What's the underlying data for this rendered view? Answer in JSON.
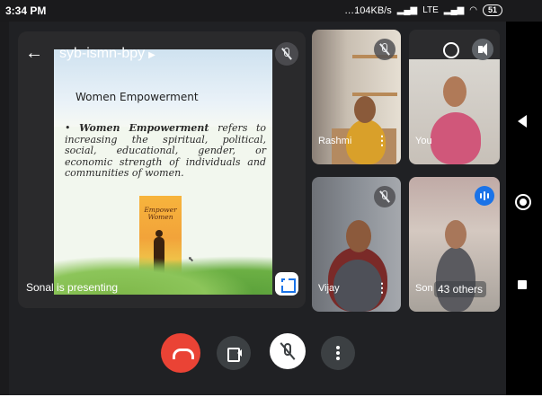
{
  "status_bar": {
    "time": "3:34 PM",
    "network_speed": "104KB/s",
    "network_type": "LTE",
    "battery": "51"
  },
  "meeting": {
    "code": "syb-ismn-bpy",
    "presenter_label": "Sonal is presenting"
  },
  "slide": {
    "title": "Women Empowerment",
    "bullet_lead": "Women Empowerment",
    "bullet_text": "refers to increasing the spiritual, political, social, educational, gender, or economic strength of individuals and communities of women.",
    "book_title_line1": "Empower",
    "book_title_line2": "Women"
  },
  "participants": [
    {
      "name": "Rashmi",
      "muted": true
    },
    {
      "name": "You",
      "muted": false
    },
    {
      "name": "Vijay",
      "muted": true
    },
    {
      "name": "Son",
      "muted": false,
      "speaking": true
    }
  ],
  "others_count_label": "43 others",
  "colors": {
    "end_call": "#ea4335",
    "accent": "#1a73e8",
    "background": "#202124"
  },
  "icons": {
    "back": "back-arrow-icon",
    "camera_switch": "camera-switch-icon",
    "speaker": "speaker-icon",
    "mic_off": "mic-off-icon",
    "end_call": "end-call-icon",
    "camera": "camera-icon",
    "more": "more-vert-icon",
    "fullscreen": "fullscreen-icon"
  }
}
